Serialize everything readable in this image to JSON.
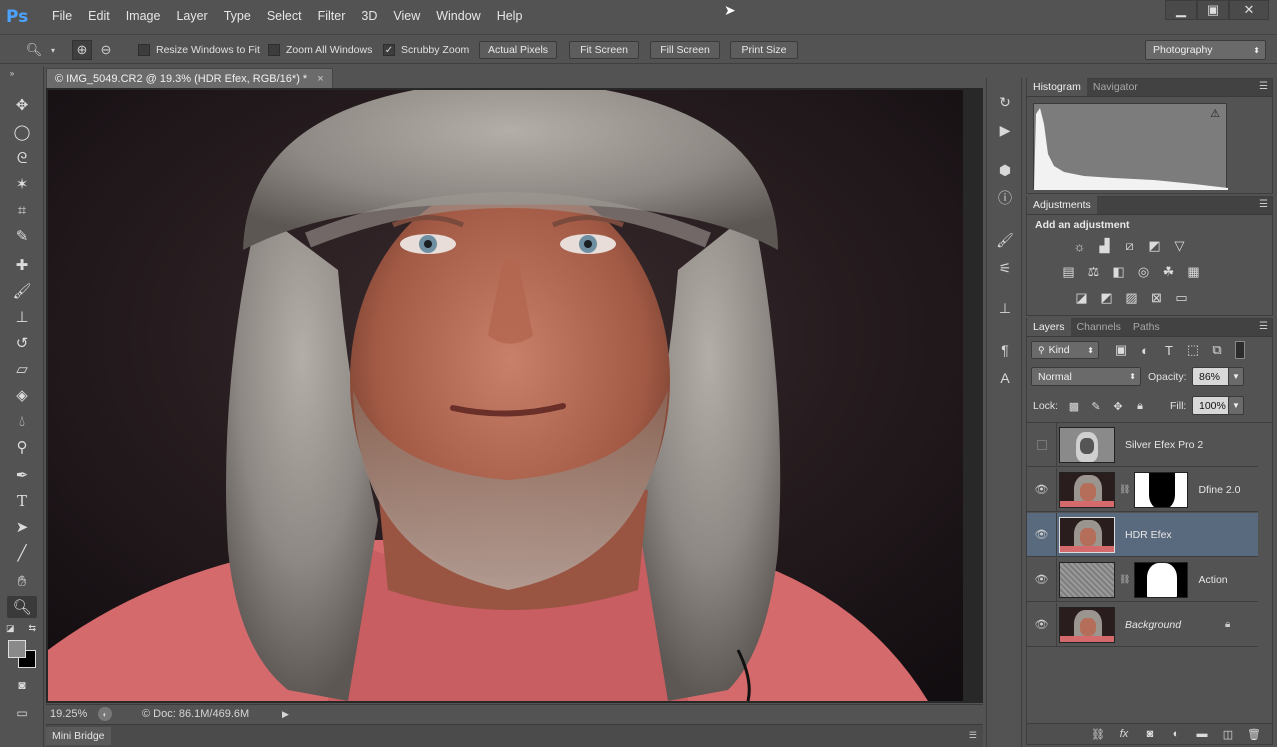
{
  "app": {
    "logo": "Ps"
  },
  "menu": [
    "File",
    "Edit",
    "Image",
    "Layer",
    "Type",
    "Select",
    "Filter",
    "3D",
    "View",
    "Window",
    "Help"
  ],
  "options": {
    "resize_windows": "Resize Windows to Fit",
    "zoom_all": "Zoom All Windows",
    "scrubby_zoom": "Scrubby Zoom",
    "actual_pixels": "Actual Pixels",
    "fit_screen": "Fit Screen",
    "fill_screen": "Fill Screen",
    "print_size": "Print Size",
    "workspace": "Photography"
  },
  "document": {
    "tab_title": "© IMG_5049.CR2 @ 19.3% (HDR Efex, RGB/16*) *",
    "zoom": "19.25%",
    "doc_info": "© Doc: 86.1M/469.6M"
  },
  "mini_bridge": "Mini Bridge",
  "panels": {
    "histogram_tab": "Histogram",
    "navigator_tab": "Navigator",
    "adjustments_tab": "Adjustments",
    "add_adjustment": "Add an adjustment",
    "layers_tab": "Layers",
    "channels_tab": "Channels",
    "paths_tab": "Paths",
    "kind": "Kind",
    "blend_mode": "Normal",
    "opacity_label": "Opacity:",
    "opacity_value": "86%",
    "lock_label": "Lock:",
    "fill_label": "Fill:",
    "fill_value": "100%"
  },
  "layers": [
    {
      "name": "Silver Efex Pro 2",
      "visible": false
    },
    {
      "name": "Dfine 2.0",
      "visible": true
    },
    {
      "name": "HDR Efex",
      "visible": true,
      "selected": true
    },
    {
      "name": "Action",
      "visible": true
    },
    {
      "name": "Background",
      "visible": true,
      "locked": true
    }
  ],
  "colors": {
    "accent": "#4ba3ff",
    "selection": "#5a6a7e"
  }
}
